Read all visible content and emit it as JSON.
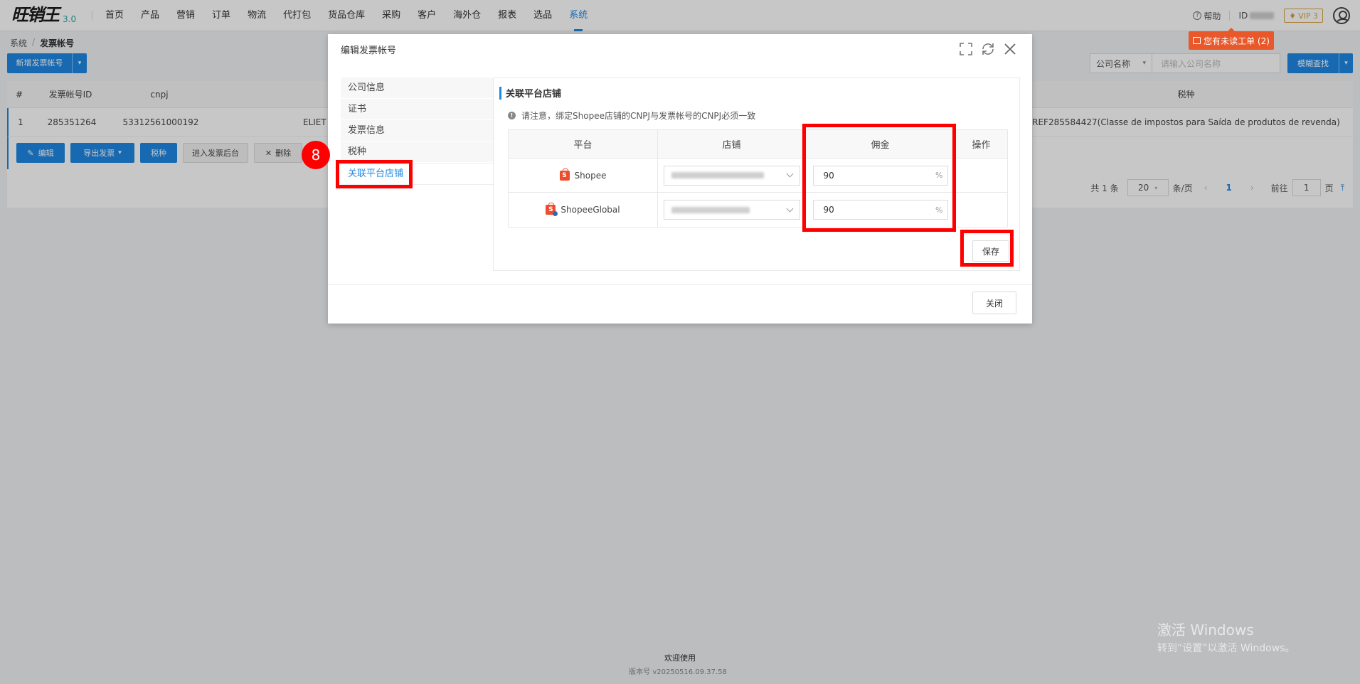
{
  "app": {
    "logo_text": "旺销王",
    "version": "3.0"
  },
  "nav": {
    "items": [
      "首页",
      "产品",
      "营销",
      "订单",
      "物流",
      "代打包",
      "货品仓库",
      "采购",
      "客户",
      "海外仓",
      "报表",
      "选品",
      "系统"
    ],
    "active": "系统"
  },
  "header": {
    "help": "帮助",
    "id_label": "ID",
    "vip": "VIP 3",
    "ticket": "您有未读工单 (2)"
  },
  "breadcrumb": {
    "root": "系统",
    "current": "发票帐号"
  },
  "toolbar": {
    "add_button": "新增发票帐号",
    "search_field": "公司名称",
    "search_placeholder": "请输入公司名称",
    "fuzzy_button": "模糊查找"
  },
  "table": {
    "headers": [
      "#",
      "发票帐号ID",
      "cnpj",
      "税种"
    ],
    "row": {
      "index": "1",
      "id": "285351264",
      "cnpj": "53312561000192",
      "company": "ELIET",
      "tax": "REF285584427(Classe de impostos para Saída de produtos de revenda)"
    },
    "actions": [
      "编辑",
      "导出发票",
      "税种",
      "进入发票后台",
      "删除"
    ]
  },
  "pagination": {
    "total": "共 1 条",
    "page_size": "20",
    "per_page": "条/页",
    "current_page": "1",
    "goto_label": "前往",
    "goto_value": "1",
    "page_unit": "页"
  },
  "modal": {
    "title": "编辑发票帐号",
    "menu": [
      "公司信息",
      "证书",
      "发票信息",
      "税种",
      "关联平台店铺"
    ],
    "active_menu": "关联平台店铺",
    "section_title": "关联平台店铺",
    "notice": "请注意，绑定Shopee店铺的CNPJ与发票帐号的CNPJ必须一致",
    "columns": [
      "平台",
      "店铺",
      "佣金",
      "操作"
    ],
    "rows": [
      {
        "platform": "Shopee",
        "commission": "90",
        "unit": "%"
      },
      {
        "platform": "ShopeeGlobal",
        "commission": "90",
        "unit": "%"
      }
    ],
    "save_button": "保存",
    "close_button": "关闭"
  },
  "annotation": {
    "step": "8"
  },
  "footer": {
    "welcome": "欢迎使用",
    "version": "版本号 v20250516.09.37.58"
  },
  "windows_activation": {
    "title": "激活 Windows",
    "subtitle": "转到“设置”以激活 Windows。"
  },
  "colors": {
    "accent": "#1e88e5",
    "highlight": "#ff0000",
    "ticket": "#e8582a",
    "shopee": "#ee4d2d"
  }
}
